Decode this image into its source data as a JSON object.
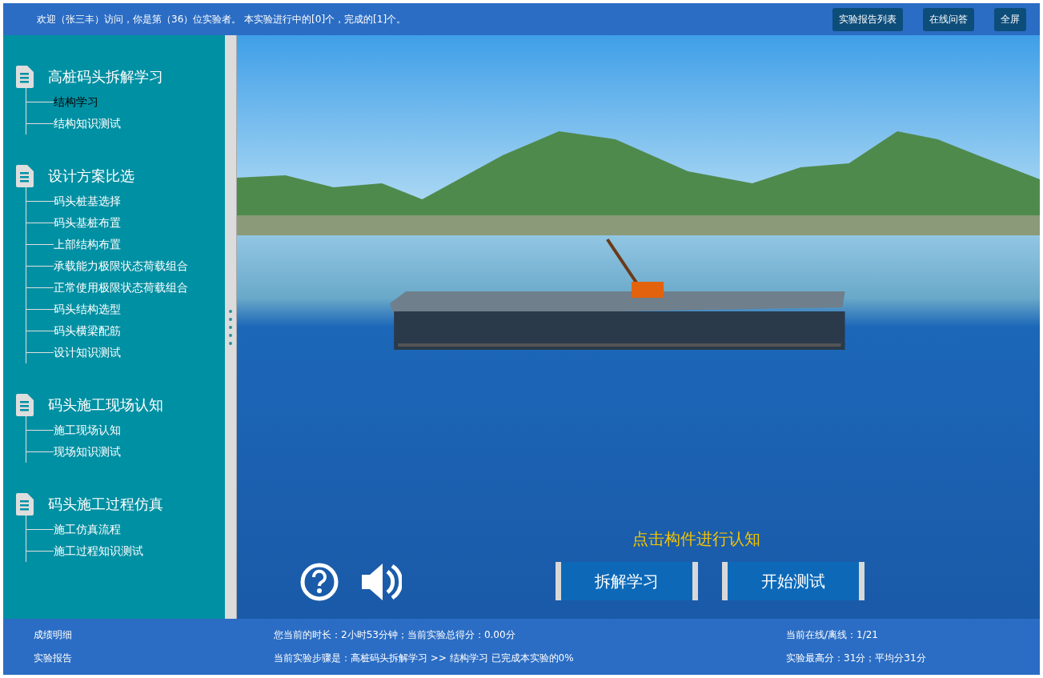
{
  "header": {
    "welcome": "欢迎（张三丰）访问，你是第（36）位实验者。 本实验进行中的[0]个，完成的[1]个。",
    "buttons": [
      "实验报告列表",
      "在线问答",
      "全屏"
    ]
  },
  "sidebar": {
    "groups": [
      {
        "title": "高桩码头拆解学习",
        "items": [
          {
            "label": "结构学习",
            "selected": true
          },
          {
            "label": "结构知识测试",
            "selected": false
          }
        ]
      },
      {
        "title": "设计方案比选",
        "items": [
          {
            "label": "码头桩基选择",
            "selected": false
          },
          {
            "label": "码头基桩布置",
            "selected": false
          },
          {
            "label": "上部结构布置",
            "selected": false
          },
          {
            "label": "承载能力极限状态荷载组合",
            "selected": false
          },
          {
            "label": "正常使用极限状态荷载组合",
            "selected": false
          },
          {
            "label": "码头结构选型",
            "selected": false
          },
          {
            "label": "码头横梁配筋",
            "selected": false
          },
          {
            "label": "设计知识测试",
            "selected": false
          }
        ]
      },
      {
        "title": "码头施工现场认知",
        "items": [
          {
            "label": "施工现场认知",
            "selected": false
          },
          {
            "label": "现场知识测试",
            "selected": false
          }
        ]
      },
      {
        "title": "码头施工过程仿真",
        "items": [
          {
            "label": "施工仿真流程",
            "selected": false
          },
          {
            "label": "施工过程知识测试",
            "selected": false
          }
        ]
      }
    ]
  },
  "scene": {
    "hint": "点击构件进行认知",
    "buttons": [
      "拆解学习",
      "开始测试"
    ]
  },
  "footer": {
    "links": [
      "成绩明细",
      "实验报告"
    ],
    "status": [
      "您当前的时长：2小时53分钟；当前实验总得分：0.00分",
      "当前实验步骤是：高桩码头拆解学习 >> 结构学习 已完成本实验的0%"
    ],
    "stats": [
      "当前在线/离线：1/21",
      "实验最高分：31分；平均分31分"
    ]
  }
}
